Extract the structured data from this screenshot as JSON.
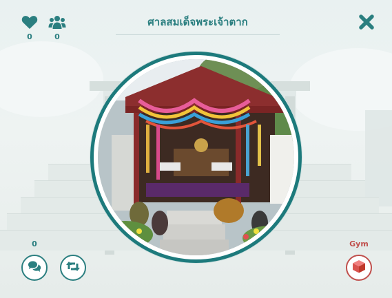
{
  "header": {
    "title": "ศาลสมเด็จพระเจ้าตาก",
    "likes_count": "0",
    "members_count": "0"
  },
  "footer": {
    "comment_count": "0",
    "gym_label": "Gym"
  },
  "icons": {
    "like": "heart-icon",
    "members": "users-icon",
    "close": "close-icon",
    "comment": "comment-icon",
    "refresh": "retweet-icon",
    "gym": "cube-icon"
  },
  "colors": {
    "teal_accent": "#2b7f80",
    "ring": "#1d7a7c",
    "gym_red": "#c0504d"
  }
}
